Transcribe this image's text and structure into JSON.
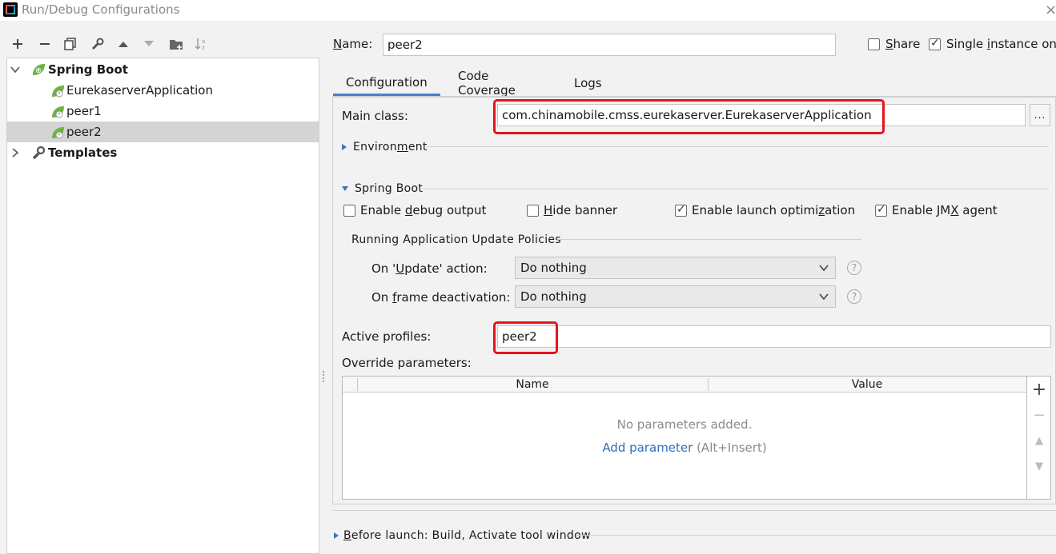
{
  "window": {
    "title": "Run/Debug Configurations",
    "close_glyph": "×"
  },
  "toolbar": {
    "icons": [
      "add-icon",
      "remove-icon",
      "copy-icon",
      "wrench-icon",
      "move-up-icon",
      "move-down-icon",
      "folder-icon",
      "sort-icon"
    ]
  },
  "tree": {
    "items": [
      {
        "label": "Spring Boot",
        "bold": true,
        "expanded": true
      },
      {
        "label": "EurekaserverApplication"
      },
      {
        "label": "peer1"
      },
      {
        "label": "peer2",
        "selected": true
      },
      {
        "label": "Templates",
        "bold": true,
        "expanded": false
      }
    ]
  },
  "header": {
    "name_label_pre": "",
    "name_label_u": "N",
    "name_label_post": "ame:",
    "name_value": "peer2",
    "share_label_u": "S",
    "share_label_post": "hare",
    "share_checked": false,
    "single_instance_pre": "Single ",
    "single_instance_u": "i",
    "single_instance_post": "nstance only",
    "single_instance_checked": true
  },
  "tabs": [
    {
      "label": "Configuration",
      "active": true
    },
    {
      "label": "Code Coverage",
      "active": false
    },
    {
      "label": "Logs",
      "active": false
    }
  ],
  "config": {
    "main_class_label": "Main class:",
    "main_class_value": "com.chinamobile.cmss.eurekaserver.EurekaserverApplication",
    "browse_label": "...",
    "environment_pre": "Environ",
    "environment_u": "m",
    "environment_post": "ent",
    "spring_boot_section": "Spring Boot",
    "options": [
      {
        "pre": "Enable ",
        "u": "d",
        "post": "ebug output",
        "checked": false
      },
      {
        "pre": "",
        "u": "H",
        "post": "ide banner",
        "checked": false
      },
      {
        "pre": "Enable launch optimi",
        "u": "z",
        "post": "ation",
        "checked": true
      },
      {
        "pre": "Enable JM",
        "u": "X",
        "post": " agent",
        "checked": true
      }
    ],
    "policies_title": "Running Application Update Policies",
    "on_update_pre": "On '",
    "on_update_u": "U",
    "on_update_post": "pdate' action:",
    "on_update_value": "Do nothing",
    "on_frame_pre": "On ",
    "on_frame_u": "f",
    "on_frame_post": "rame deactivation:",
    "on_frame_value": "Do nothing",
    "help_glyph": "?",
    "active_profiles_label": "Active profiles:",
    "active_profiles_value": "peer2",
    "override_label": "Override parameters:",
    "table": {
      "columns": [
        "Name",
        "Value"
      ],
      "empty_text": "No parameters added.",
      "add_link": "Add parameter",
      "add_hint": " (Alt+Insert)"
    },
    "side_buttons": [
      "+",
      "−",
      "▲",
      "▼"
    ]
  },
  "before_launch": {
    "pre": "",
    "u": "B",
    "post": "efore launch: Build, Activate tool window"
  },
  "colors": {
    "highlight_box": "#e5141b",
    "link": "#2f6fb7",
    "tab_active": "#4083c9",
    "spring_green": "#6db33f"
  }
}
